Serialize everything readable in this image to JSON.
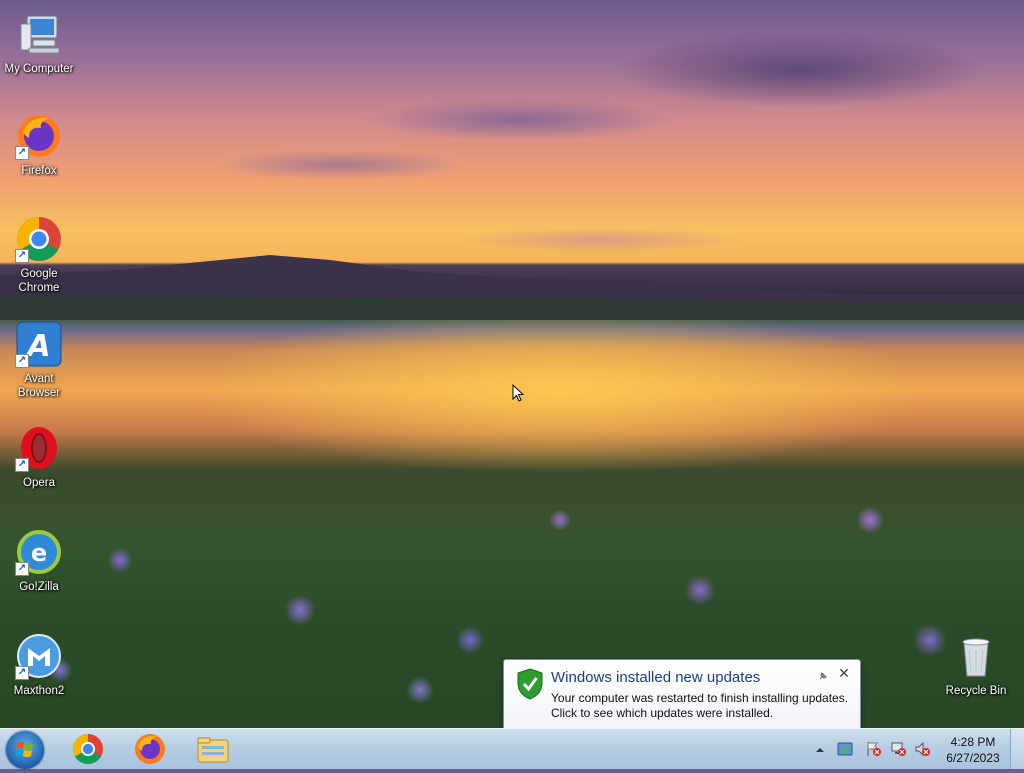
{
  "desktop": {
    "icons": [
      {
        "label": "My Computer",
        "icon": "computer-icon"
      },
      {
        "label": "Firefox",
        "icon": "firefox-icon"
      },
      {
        "label": "Google Chrome",
        "icon": "chrome-icon"
      },
      {
        "label": "Avant Browser",
        "icon": "avant-browser-icon"
      },
      {
        "label": "Opera",
        "icon": "opera-icon"
      },
      {
        "label": "Go!Zilla",
        "icon": "gozilla-icon"
      },
      {
        "label": "Maxthon2",
        "icon": "maxthon-icon"
      },
      {
        "label": "Recycle Bin",
        "icon": "recycle-bin-icon"
      }
    ]
  },
  "notification": {
    "title": "Windows installed new updates",
    "line1": "Your computer was restarted to finish installing updates.",
    "line2": "Click to see which updates were installed."
  },
  "taskbar": {
    "pinned": [
      "chrome-icon",
      "firefox-icon",
      "file-explorer-icon"
    ],
    "clock": {
      "time": "4:28 PM",
      "date": "6/27/2023"
    }
  },
  "colors": {
    "taskbar": "#b6cde3",
    "notification_title": "#1b3f8b",
    "shield_green": "#2e9c2e"
  }
}
